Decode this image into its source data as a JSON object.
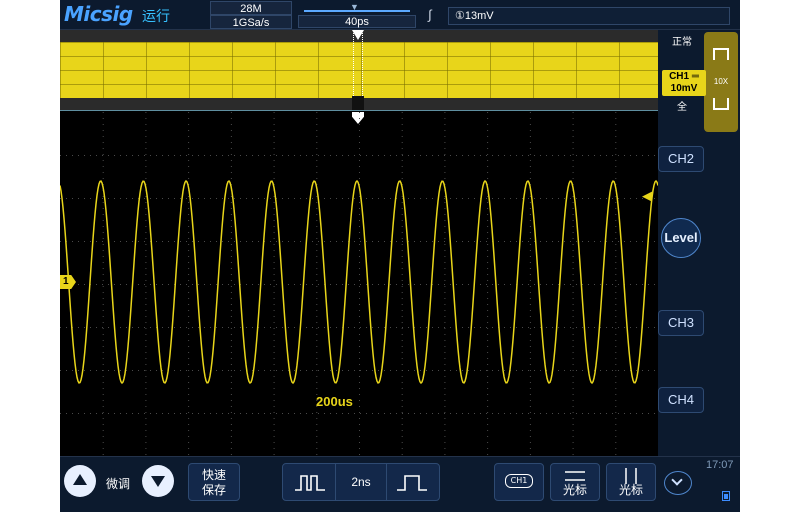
{
  "header": {
    "logo": "Micsig",
    "run_status": "运行",
    "memory_depth": "28M",
    "sample_rate": "1GSa/s",
    "time_offset": "40ps",
    "trigger_level": "①13mV"
  },
  "channel1": {
    "label": "CH1 ═",
    "scale": "10mV",
    "coupling": "全",
    "probe": "10X",
    "color": "#e8d51a",
    "marker": "1"
  },
  "right_panel": {
    "acq_mode": "正常",
    "ch2": "CH2",
    "ch3": "CH3",
    "ch4": "CH4",
    "level": "Level"
  },
  "display": {
    "timebase": "200us",
    "waveform_cycles": 14
  },
  "bottom": {
    "fine": "微调",
    "quicksave_line1": "快速",
    "quicksave_line2": "保存",
    "pulse_width": "2ns",
    "ch1_badge": "CH1",
    "cursor_h": "光标",
    "cursor_v": "光标",
    "time": "17:07"
  }
}
